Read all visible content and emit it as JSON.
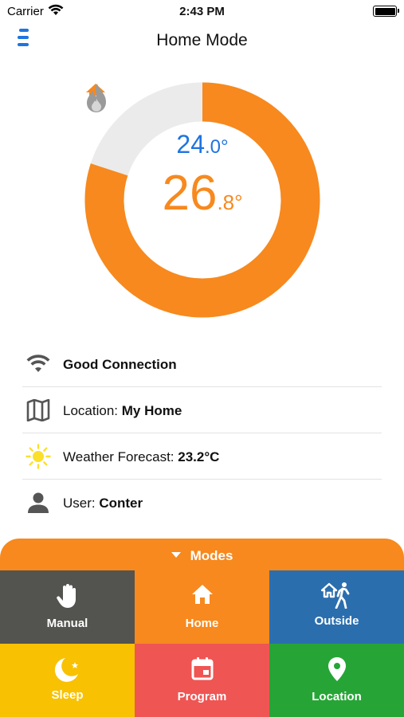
{
  "status_bar": {
    "carrier": "Carrier",
    "time": "2:43 PM"
  },
  "header": {
    "title": "Home Mode"
  },
  "thermostat": {
    "setpoint_int": "24",
    "setpoint_dec": ".0°",
    "current_int": "26",
    "current_dec": ".8°",
    "ring_fill_fraction": 0.8,
    "ring_color": "#f7891e",
    "ring_track_color": "#ebebeb",
    "setpoint_color": "#1e74e0"
  },
  "info": {
    "connection": "Good Connection",
    "location_label": "Location: ",
    "location_value": "My Home",
    "weather_label": "Weather Forecast: ",
    "weather_value": "23.2°C",
    "user_label": "User: ",
    "user_value": "Conter"
  },
  "modes": {
    "toggle_label": "Modes",
    "tiles": [
      {
        "label": "Manual",
        "icon": "hand-icon",
        "color": "#53534f"
      },
      {
        "label": "Home",
        "icon": "home-icon",
        "color": "#f7891e"
      },
      {
        "label": "Outside",
        "icon": "walking-person-icon",
        "color": "#2b6eae"
      },
      {
        "label": "Sleep",
        "icon": "moon-icon",
        "color": "#f8c102"
      },
      {
        "label": "Program",
        "icon": "calendar-icon",
        "color": "#ef5553"
      },
      {
        "label": "Location",
        "icon": "map-pin-icon",
        "color": "#26a536"
      }
    ]
  }
}
